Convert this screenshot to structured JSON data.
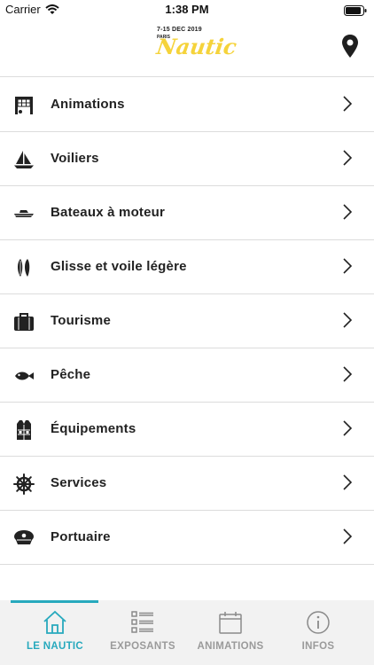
{
  "status_bar": {
    "carrier": "Carrier",
    "time": "1:38 PM"
  },
  "header": {
    "logo": {
      "dates": "7-15 DEC 2019",
      "city": "PARIS",
      "word": "Nautic"
    }
  },
  "menu": {
    "items": [
      {
        "label": "Animations",
        "icon": "animations-icon"
      },
      {
        "label": "Voiliers",
        "icon": "sailboat-icon"
      },
      {
        "label": "Bateaux à moteur",
        "icon": "motorboat-icon"
      },
      {
        "label": "Glisse et voile légère",
        "icon": "surfboard-icon"
      },
      {
        "label": "Tourisme",
        "icon": "suitcase-icon"
      },
      {
        "label": "Pêche",
        "icon": "fish-icon"
      },
      {
        "label": "Équipements",
        "icon": "life-vest-icon"
      },
      {
        "label": "Services",
        "icon": "helm-icon"
      },
      {
        "label": "Portuaire",
        "icon": "captain-hat-icon"
      }
    ]
  },
  "tabbar": {
    "tabs": [
      {
        "label": "LE NAUTIC",
        "active": true
      },
      {
        "label": "EXPOSANTS",
        "active": false
      },
      {
        "label": "ANIMATIONS",
        "active": false
      },
      {
        "label": "INFOS",
        "active": false
      }
    ]
  },
  "colors": {
    "accent": "#27a9bd",
    "logo_yellow": "#f5d33b",
    "inactive": "#9a9a9a"
  }
}
